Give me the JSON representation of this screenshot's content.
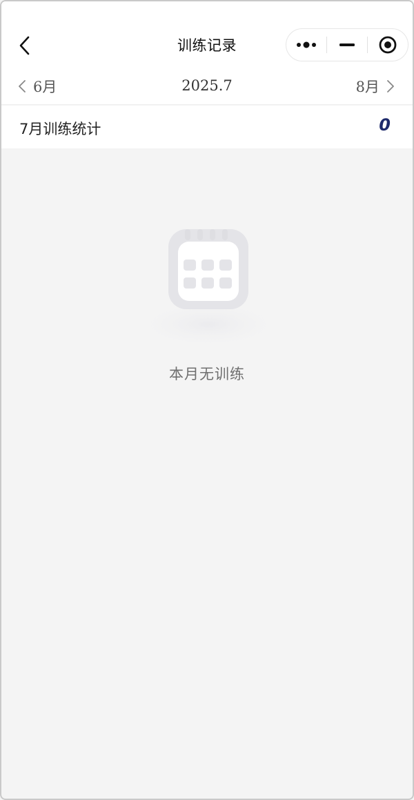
{
  "header": {
    "title": "训练记录",
    "back_icon": "chevron-left-icon",
    "capsule": {
      "more_icon": "more-dots-icon",
      "minimize_icon": "minimize-icon",
      "close_icon": "target-circle-icon"
    }
  },
  "month_nav": {
    "prev_label": "6月",
    "current": "2025.7",
    "next_label": "8月"
  },
  "stats": {
    "label": "7月训练统计",
    "count": "0",
    "count_color": "#1e2a6b"
  },
  "empty_state": {
    "icon": "calendar-icon",
    "message": "本月无训练"
  }
}
